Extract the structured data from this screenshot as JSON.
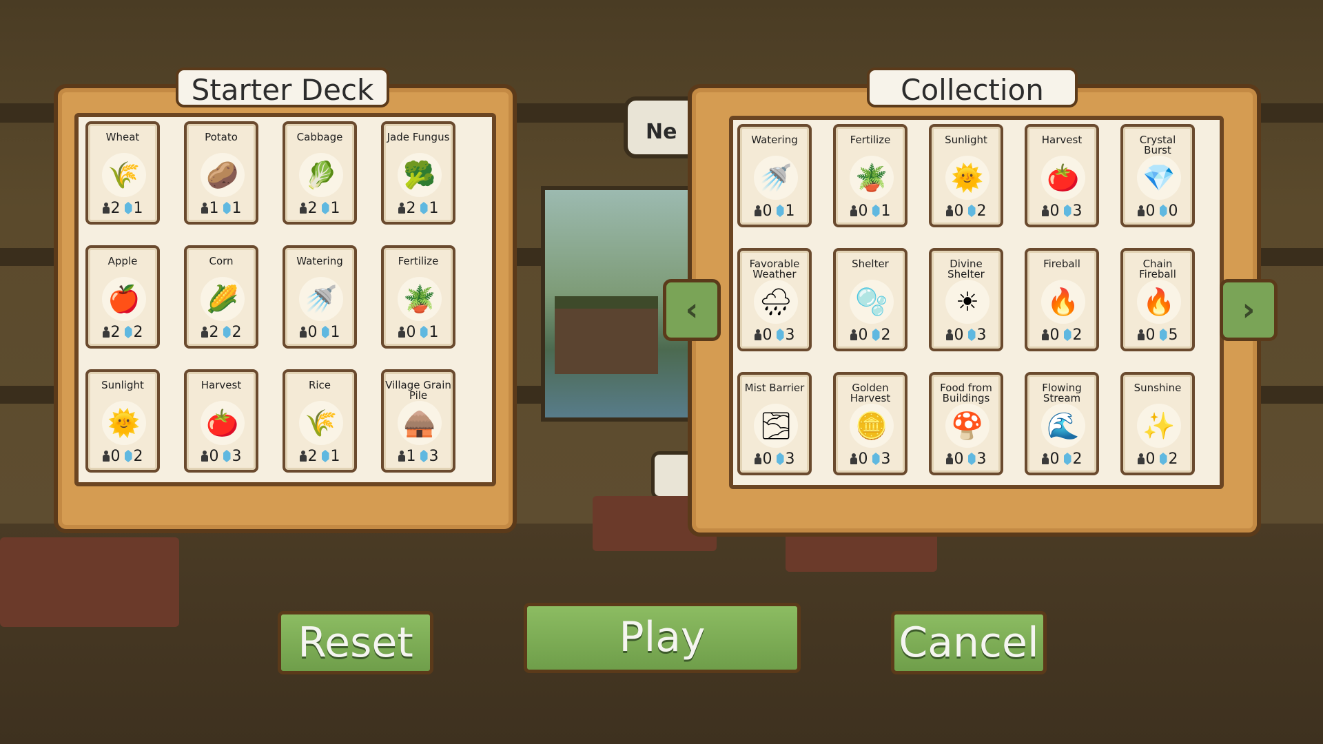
{
  "starter_deck": {
    "title": "Starter Deck",
    "cards": [
      {
        "name": "Wheat",
        "icon": "wheat-icon",
        "glyph": "🌾",
        "people": "2",
        "crystals": "1"
      },
      {
        "name": "Potato",
        "icon": "potato-icon",
        "glyph": "🥔",
        "people": "1",
        "crystals": "1"
      },
      {
        "name": "Cabbage",
        "icon": "cabbage-icon",
        "glyph": "🥬",
        "people": "2",
        "crystals": "1"
      },
      {
        "name": "Jade Fungus",
        "icon": "jade-fungus-icon",
        "glyph": "🥦",
        "people": "2",
        "crystals": "1"
      },
      {
        "name": "Apple",
        "icon": "apple-icon",
        "glyph": "🍎",
        "people": "2",
        "crystals": "2"
      },
      {
        "name": "Corn",
        "icon": "corn-icon",
        "glyph": "🌽",
        "people": "2",
        "crystals": "2"
      },
      {
        "name": "Watering",
        "icon": "watering-icon",
        "glyph": "🚿",
        "people": "0",
        "crystals": "1"
      },
      {
        "name": "Fertilize",
        "icon": "fertilize-icon",
        "glyph": "🪴",
        "people": "0",
        "crystals": "1"
      },
      {
        "name": "Sunlight",
        "icon": "sunlight-icon",
        "glyph": "🌞",
        "people": "0",
        "crystals": "2"
      },
      {
        "name": "Harvest",
        "icon": "harvest-icon",
        "glyph": "🍅",
        "people": "0",
        "crystals": "3"
      },
      {
        "name": "Rice",
        "icon": "rice-icon",
        "glyph": "🌾",
        "people": "2",
        "crystals": "1"
      },
      {
        "name": "Village Grain Pile",
        "icon": "grain-pile-icon",
        "glyph": "🛖",
        "people": "1",
        "crystals": "3"
      }
    ]
  },
  "collection": {
    "title": "Collection",
    "cards": [
      {
        "name": "Watering",
        "icon": "watering-icon",
        "glyph": "🚿",
        "people": "0",
        "crystals": "1"
      },
      {
        "name": "Fertilize",
        "icon": "fertilize-icon",
        "glyph": "🪴",
        "people": "0",
        "crystals": "1"
      },
      {
        "name": "Sunlight",
        "icon": "sunlight-icon",
        "glyph": "🌞",
        "people": "0",
        "crystals": "2"
      },
      {
        "name": "Harvest",
        "icon": "harvest-icon",
        "glyph": "🍅",
        "people": "0",
        "crystals": "3"
      },
      {
        "name": "Crystal Burst",
        "icon": "crystal-burst-icon",
        "glyph": "💎",
        "people": "0",
        "crystals": "0"
      },
      {
        "name": "Favorable Weather",
        "icon": "weather-icon",
        "glyph": "🌧",
        "people": "0",
        "crystals": "3"
      },
      {
        "name": "Shelter",
        "icon": "shelter-icon",
        "glyph": "🫧",
        "people": "0",
        "crystals": "2"
      },
      {
        "name": "Divine Shelter",
        "icon": "divine-shelter-icon",
        "glyph": "☀",
        "people": "0",
        "crystals": "3"
      },
      {
        "name": "Fireball",
        "icon": "fireball-icon",
        "glyph": "🔥",
        "people": "0",
        "crystals": "2"
      },
      {
        "name": "Chain Fireball",
        "icon": "chain-fireball-icon",
        "glyph": "🔥",
        "people": "0",
        "crystals": "5"
      },
      {
        "name": "Mist Barrier",
        "icon": "mist-barrier-icon",
        "glyph": "🌫",
        "people": "0",
        "crystals": "3"
      },
      {
        "name": "Golden Harvest",
        "icon": "golden-harvest-icon",
        "glyph": "🪙",
        "people": "0",
        "crystals": "3"
      },
      {
        "name": "Food from Buildings",
        "icon": "food-building-icon",
        "glyph": "🍄",
        "people": "0",
        "crystals": "3"
      },
      {
        "name": "Flowing Stream",
        "icon": "stream-icon",
        "glyph": "🌊",
        "people": "0",
        "crystals": "2"
      },
      {
        "name": "Sunshine",
        "icon": "sunshine-icon",
        "glyph": "✨",
        "people": "0",
        "crystals": "2"
      }
    ]
  },
  "navigation": {
    "prev_glyph": "‹",
    "next_glyph": "›"
  },
  "background_sign": {
    "text": "Ne"
  },
  "buttons": {
    "reset": "Reset",
    "play": "Play",
    "cancel": "Cancel"
  },
  "colors": {
    "panel": "#d59c52",
    "button": "#7aa457",
    "card": "#f4ead6"
  }
}
